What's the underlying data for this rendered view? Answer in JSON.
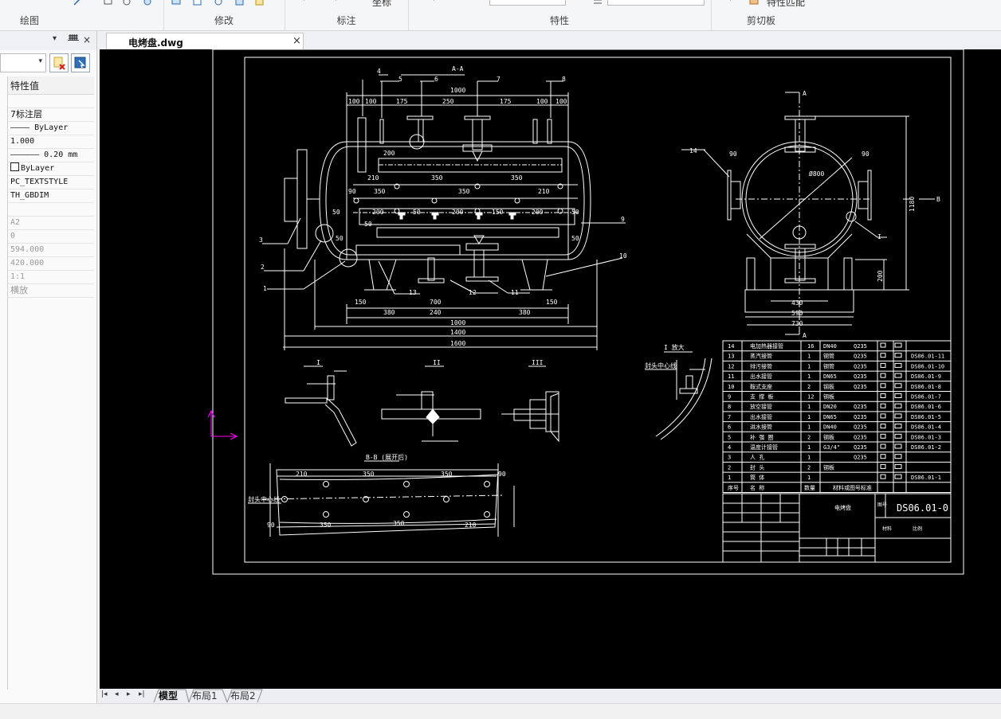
{
  "ribbon": {
    "groups": [
      {
        "id": "draw",
        "label": "绘图"
      },
      {
        "id": "modify",
        "label": "修改"
      },
      {
        "id": "annotate",
        "label": "标注"
      },
      {
        "id": "properties",
        "label": "特性"
      },
      {
        "id": "clipboard",
        "label": "剪切板"
      }
    ],
    "coord_button": "坐标",
    "match_props_button": "特性匹配"
  },
  "document_tab": {
    "title": "电烤盘.dwg",
    "close": "×"
  },
  "panel": {
    "buttons": [
      "▾",
      "ᚙ",
      "×"
    ],
    "header": "特性值",
    "properties": [
      {
        "value": "",
        "style": ""
      },
      {
        "value": "7标注层",
        "style": "cjk"
      },
      {
        "value": "———— ByLayer",
        "style": ""
      },
      {
        "value": "1.000",
        "style": ""
      },
      {
        "value": "—————— 0.20 mm",
        "style": ""
      },
      {
        "value": "ByLayer",
        "style": "box"
      },
      {
        "value": "PC_TEXTSTYLE",
        "style": ""
      },
      {
        "value": "TH_GBDIM",
        "style": ""
      },
      {
        "value": "",
        "style": ""
      },
      {
        "value": "A2",
        "style": "gray"
      },
      {
        "value": "0",
        "style": "gray"
      },
      {
        "value": "594.000",
        "style": "gray"
      },
      {
        "value": "420.000",
        "style": "gray"
      },
      {
        "value": "1:1",
        "style": "gray"
      },
      {
        "value": "横放",
        "style": "gray cjk"
      }
    ]
  },
  "layout_tabs": {
    "nav": [
      "|◂",
      "◂",
      "▸",
      "▸|"
    ],
    "tabs": [
      "模型",
      "布局1",
      "布局2"
    ],
    "active": 0
  },
  "drawing": {
    "section_title": "A-A",
    "callouts": [
      "1",
      "2",
      "3",
      "4",
      "5",
      "6",
      "7",
      "8",
      "9",
      "10",
      "11",
      "12",
      "13",
      "14"
    ],
    "top_dims": [
      "100",
      "100",
      "175",
      "250",
      "175",
      "100",
      "100"
    ],
    "dims": {
      "d1000_top": "1000",
      "d350": "350",
      "d200": "200",
      "d210": "210",
      "d150": "150",
      "d700": "700",
      "d380": "380",
      "d240": "240",
      "d1000": "1000",
      "d1400": "1400",
      "d1600": "1600",
      "d50": "50",
      "d90": "90",
      "side_430": "430",
      "side_590": "590",
      "side_730": "730",
      "side_200": "200",
      "side_1180": "1180",
      "side_dia": "Ø800"
    },
    "side_labels": {
      "a_top": "A",
      "a_bot": "A",
      "b": "B",
      "i_label": "I"
    },
    "detail_labels": {
      "i_big": "I 放大",
      "bb": "B-B (展开后)",
      "center_line": "封头中心线",
      "d1": "I",
      "d2": "II",
      "d3": "III"
    },
    "bb_dims": [
      "210",
      "350",
      "350",
      "90",
      "90",
      "350",
      "350",
      "210"
    ],
    "bom": [
      {
        "no": "14",
        "name": "电加热器接管",
        "qty": "16",
        "mat": "DN40",
        "std": "Q235",
        "code": ""
      },
      {
        "no": "13",
        "name": "蒸汽接管",
        "qty": "1",
        "mat": "钢管",
        "std": "Q235",
        "code": "DS06.01-11"
      },
      {
        "no": "12",
        "name": "排污接管",
        "qty": "1",
        "mat": "钢管",
        "std": "Q235",
        "code": "DS06.01-10"
      },
      {
        "no": "11",
        "name": "出水接管",
        "qty": "1",
        "mat": "DN65",
        "std": "Q235",
        "code": "DS06.01-9"
      },
      {
        "no": "10",
        "name": "鞍式支座",
        "qty": "2",
        "mat": "钢板",
        "std": "Q235",
        "code": "DS06.01-8"
      },
      {
        "no": "9",
        "name": "支 撑 板",
        "qty": "12",
        "mat": "钢板",
        "std": "",
        "code": "DS06.01-7"
      },
      {
        "no": "8",
        "name": "放空接管",
        "qty": "1",
        "mat": "DN20",
        "std": "Q235",
        "code": "DS06.01-6"
      },
      {
        "no": "7",
        "name": "出水接管",
        "qty": "1",
        "mat": "DN65",
        "std": "Q235",
        "code": "DS06.01-5"
      },
      {
        "no": "6",
        "name": "进水接管",
        "qty": "1",
        "mat": "DN40",
        "std": "Q235",
        "code": "DS06.01-4"
      },
      {
        "no": "5",
        "name": "补 强 圈",
        "qty": "2",
        "mat": "钢板",
        "std": "Q235",
        "code": "DS06.01-3"
      },
      {
        "no": "4",
        "name": "温度计接管",
        "qty": "1",
        "mat": "G3/4\"",
        "std": "Q235",
        "code": "DS06.01-2"
      },
      {
        "no": "3",
        "name": "人 孔",
        "qty": "1",
        "mat": "",
        "std": "Q235",
        "code": ""
      },
      {
        "no": "2",
        "name": "封 头",
        "qty": "2",
        "mat": "钢板",
        "std": "",
        "code": ""
      },
      {
        "no": "1",
        "name": "筒 体",
        "qty": "1",
        "mat": "",
        "std": "",
        "code": "DS06.01-1"
      }
    ],
    "bom_header": {
      "no": "序号",
      "name": "名 称",
      "qty": "数量",
      "std": "材料或图号标准"
    },
    "title_block": {
      "name": "电烤盘",
      "drawing_no": "DS06.01-0",
      "code_label": "图号",
      "label_a": "材料",
      "label_b": "比例"
    }
  },
  "colors": {
    "canvas": "#000000",
    "line": "#ffffff",
    "ucs": "#ff00ff",
    "ribbon": "#f5f6f7"
  }
}
